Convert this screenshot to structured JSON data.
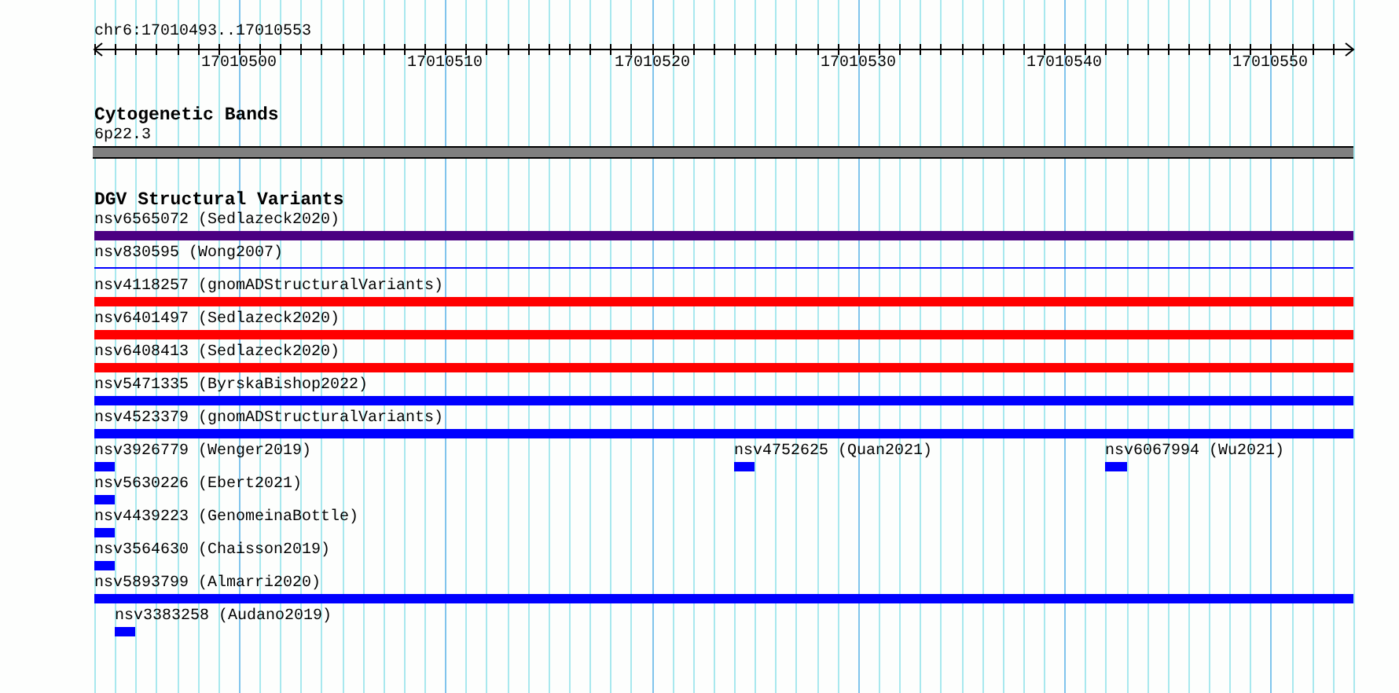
{
  "ruler": {
    "region": "chr6:17010493..17010553",
    "tick_labels": [
      "17010500",
      "17010510",
      "17010520",
      "17010530",
      "17010540",
      "17010550"
    ]
  },
  "cytogenetic_bands": {
    "title": "Cytogenetic Bands",
    "band": "6p22.3"
  },
  "dgv_track": {
    "title": "DGV Structural Variants",
    "rows": [
      {
        "features": [
          {
            "label": "nsv6565072 (Sedlazeck2020)",
            "kind": "bar",
            "color": "#4b0082"
          }
        ]
      },
      {
        "features": [
          {
            "label": "nsv830595 (Wong2007)",
            "kind": "line",
            "color": "#0000ff"
          }
        ]
      },
      {
        "features": [
          {
            "label": "nsv4118257 (gnomADStructuralVariants)",
            "kind": "bar",
            "color": "#ff0000"
          }
        ]
      },
      {
        "features": [
          {
            "label": "nsv6401497 (Sedlazeck2020)",
            "kind": "bar",
            "color": "#ff0000"
          }
        ]
      },
      {
        "features": [
          {
            "label": "nsv6408413 (Sedlazeck2020)",
            "kind": "bar",
            "color": "#ff0000"
          }
        ]
      },
      {
        "features": [
          {
            "label": "nsv5471335 (ByrskaBishop2022)",
            "kind": "bar",
            "color": "#0000ff"
          }
        ]
      },
      {
        "features": [
          {
            "label": "nsv4523379 (gnomADStructuralVariants)",
            "kind": "bar",
            "color": "#0000ff"
          }
        ]
      },
      {
        "features": [
          {
            "label": "nsv3926779 (Wenger2019)",
            "kind": "block",
            "color": "#0000ff"
          },
          {
            "label": "nsv4752625 (Quan2021)",
            "kind": "block",
            "color": "#0000ff"
          },
          {
            "label": "nsv6067994 (Wu2021)",
            "kind": "block",
            "color": "#0000ff"
          }
        ]
      },
      {
        "features": [
          {
            "label": "nsv5630226 (Ebert2021)",
            "kind": "block",
            "color": "#0000ff"
          }
        ]
      },
      {
        "features": [
          {
            "label": "nsv4439223 (GenomeinaBottle)",
            "kind": "block",
            "color": "#0000ff"
          }
        ]
      },
      {
        "features": [
          {
            "label": "nsv3564630 (Chaisson2019)",
            "kind": "block",
            "color": "#0000ff"
          }
        ]
      },
      {
        "features": [
          {
            "label": "nsv5893799 (Almarri2020)",
            "kind": "bar",
            "color": "#0000ff"
          }
        ]
      },
      {
        "features": [
          {
            "label": "nsv3383258 (Audano2019)",
            "kind": "block",
            "color": "#0000ff"
          }
        ]
      }
    ]
  }
}
